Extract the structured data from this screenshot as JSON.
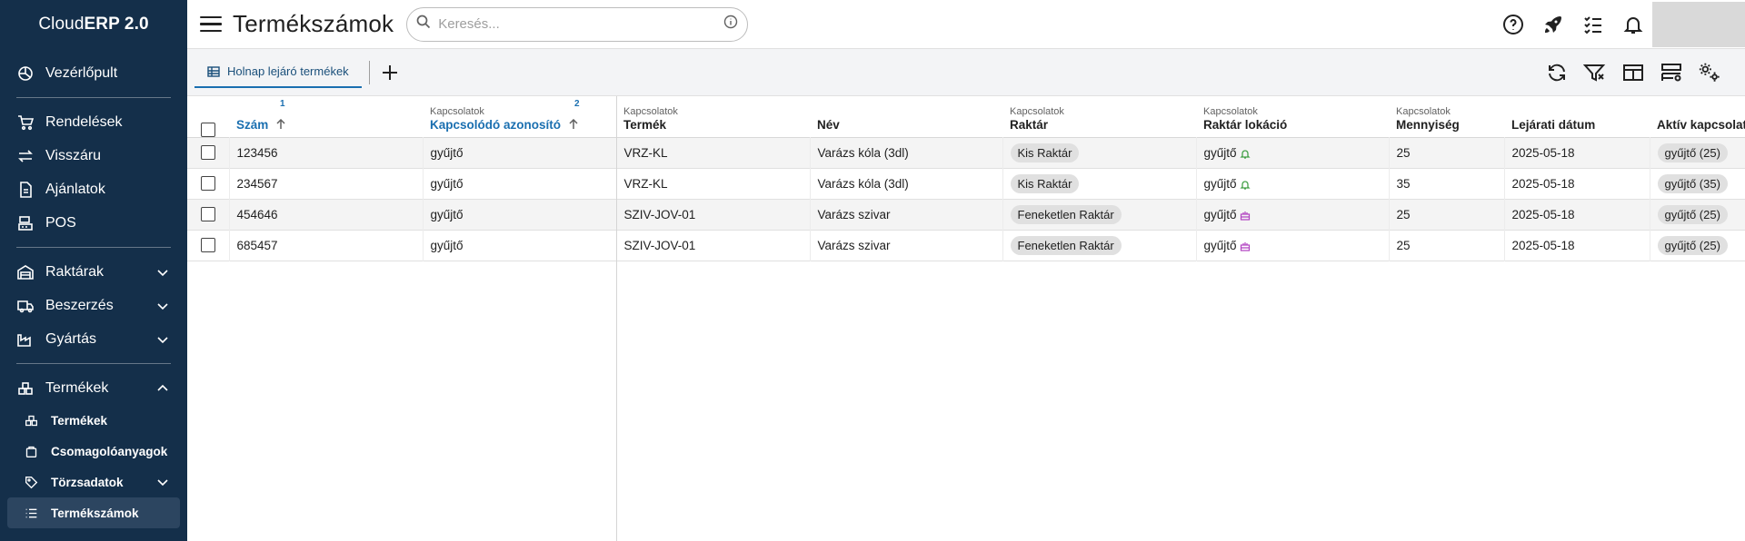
{
  "app": {
    "brand_prefix": "Cloud",
    "brand_main": "ERP 2.0"
  },
  "sidebar": {
    "items": [
      {
        "label": "Vezérlőpult",
        "icon": "dashboard-icon"
      },
      {
        "label": "Rendelések",
        "icon": "cart-icon"
      },
      {
        "label": "Visszáru",
        "icon": "swap-icon"
      },
      {
        "label": "Ajánlatok",
        "icon": "document-icon"
      },
      {
        "label": "POS",
        "icon": "register-icon"
      },
      {
        "label": "Raktárak",
        "icon": "warehouse-icon"
      },
      {
        "label": "Beszerzés",
        "icon": "truck-icon"
      },
      {
        "label": "Gyártás",
        "icon": "factory-icon"
      },
      {
        "label": "Termékek",
        "icon": "boxes-icon"
      }
    ],
    "subitems": [
      {
        "label": "Termékek",
        "icon": "boxes-icon"
      },
      {
        "label": "Csomagolóanyagok",
        "icon": "package-icon"
      },
      {
        "label": "Törzsadatok",
        "icon": "tag-icon"
      },
      {
        "label": "Termékszámok",
        "icon": "list-icon"
      }
    ]
  },
  "header": {
    "title": "Termékszámok",
    "search_placeholder": "Keresés..."
  },
  "tabs": [
    {
      "label": "Holnap lejáró termékek"
    }
  ],
  "table": {
    "columns": [
      {
        "group": "",
        "label": "Szám",
        "sort_index": "1"
      },
      {
        "group": "Kapcsolatok",
        "label": "Kapcsolódó azonosító",
        "sort_index": "2"
      },
      {
        "group": "Kapcsolatok",
        "label": "Termék"
      },
      {
        "group": "",
        "label": "Név"
      },
      {
        "group": "Kapcsolatok",
        "label": "Raktár"
      },
      {
        "group": "Kapcsolatok",
        "label": "Raktár lokáció"
      },
      {
        "group": "Kapcsolatok",
        "label": "Mennyiség"
      },
      {
        "group": "",
        "label": "Lejárati dátum"
      },
      {
        "group": "",
        "label": "Aktív kapcsolat"
      }
    ],
    "rows": [
      {
        "szam": "123456",
        "kapcs": "gyűjtő",
        "termek": "VRZ-KL",
        "nev": "Varázs kóla (3dl)",
        "raktar": "Kis Raktár",
        "lokacio": "gyűjtő",
        "lok_icon": "bell-icon",
        "mennyiseg": "25",
        "datum": "2025-05-18",
        "aktiv": "gyűjtő (25)"
      },
      {
        "szam": "234567",
        "kapcs": "gyűjtő",
        "termek": "VRZ-KL",
        "nev": "Varázs kóla (3dl)",
        "raktar": "Kis Raktár",
        "lokacio": "gyűjtő",
        "lok_icon": "bell-icon",
        "mennyiseg": "35",
        "datum": "2025-05-18",
        "aktiv": "gyűjtő (35)"
      },
      {
        "szam": "454646",
        "kapcs": "gyűjtő",
        "termek": "SZIV-JOV-01",
        "nev": "Varázs szivar",
        "raktar": "Feneketlen Raktár",
        "lokacio": "gyűjtő",
        "lok_icon": "cake-icon",
        "mennyiseg": "25",
        "datum": "2025-05-18",
        "aktiv": "gyűjtő (25)"
      },
      {
        "szam": "685457",
        "kapcs": "gyűjtő",
        "termek": "SZIV-JOV-01",
        "nev": "Varázs szivar",
        "raktar": "Feneketlen Raktár",
        "lokacio": "gyűjtő",
        "lok_icon": "cake-icon",
        "mennyiseg": "25",
        "datum": "2025-05-18",
        "aktiv": "gyűjtő (25)"
      }
    ]
  },
  "colors": {
    "sidebar_bg": "#142f4a",
    "accent": "#1a6fb0",
    "bell_green": "#43a047",
    "cake_purple": "#b040c0"
  }
}
